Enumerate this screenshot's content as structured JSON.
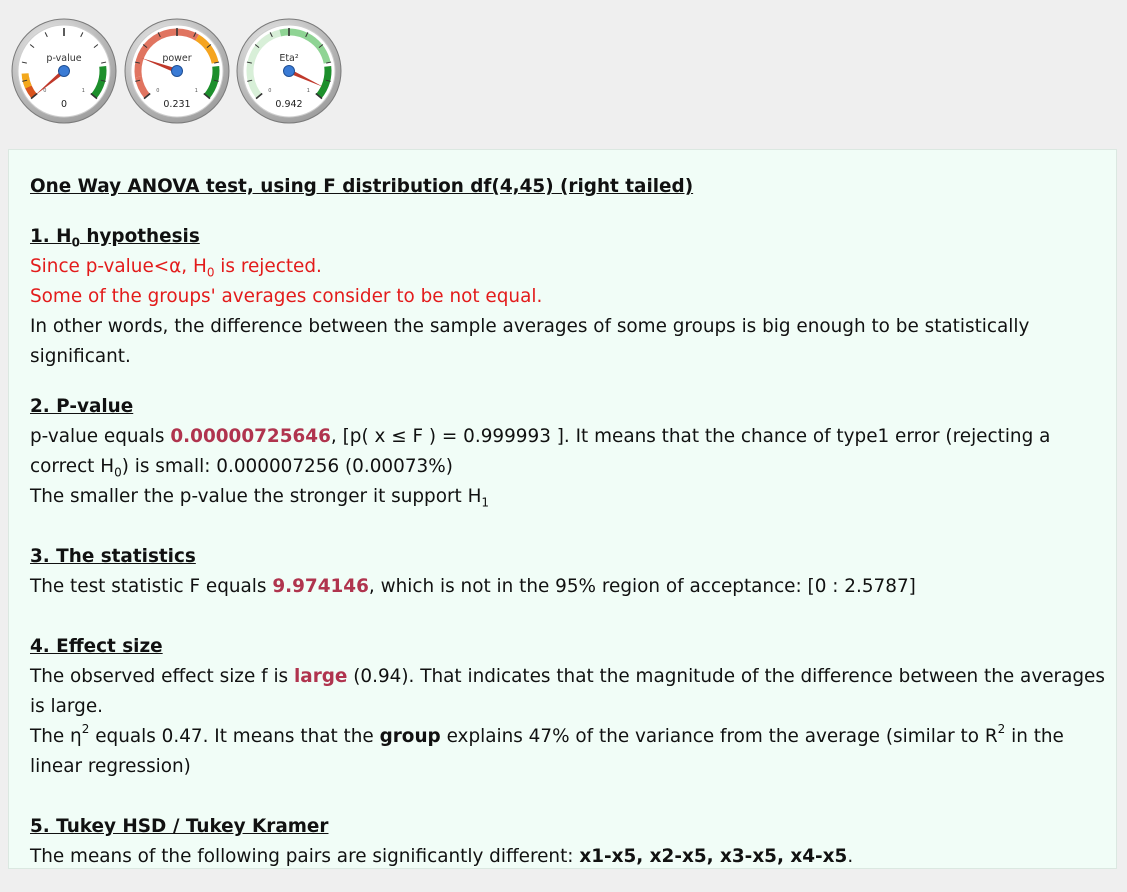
{
  "gauges": [
    {
      "label": "p-value",
      "value_text": "0",
      "value": 0,
      "min_tick": "0",
      "max_tick": "1",
      "colors": {
        "face": "#ffffff",
        "band_low": "#d9541e",
        "band_mid": "#f3a81c",
        "band_high": "#1d8f2c"
      }
    },
    {
      "label": "power",
      "value_text": "0.231",
      "value": 0.231,
      "min_tick": "0",
      "max_tick": "1",
      "colors": {
        "face": "#ffffff",
        "band_low": "#e07460",
        "band_mid": "#f5a41f",
        "band_high": "#1d8f2c"
      }
    },
    {
      "label": "Eta²",
      "value_text": "0.942",
      "value": 0.942,
      "min_tick": "0",
      "max_tick": "1",
      "colors": {
        "face": "#ffffff",
        "band_low": "#d8efd8",
        "band_mid": "#8fd494",
        "band_high": "#1d8f2c"
      }
    }
  ],
  "report": {
    "title": "One Way ANOVA test, using F distribution df(4,45) (right tailed)",
    "s1": {
      "heading_a": "1. H",
      "heading_sub": "0",
      "heading_b": " hypothesis",
      "line1_a": "Since p-value<α, H",
      "line1_sub": "0",
      "line1_b": " is rejected.",
      "line2": "Some of the groups' averages consider to be not equal.",
      "line3": "In other words, the difference between the sample averages of some groups is big enough to be statistically significant."
    },
    "s2": {
      "heading": "2. P-value",
      "a": "p-value equals ",
      "pvalue": "0.00000725646",
      "b": ", [p( x ≤ F ) = 0.999993 ]. It means that the chance of type1 error (rejecting a correct H",
      "b_sub": "0",
      "c": ") is small: 0.000007256 (0.00073%)",
      "line2_a": "The smaller the p-value the stronger it support H",
      "line2_sub": "1"
    },
    "s3": {
      "heading": "3. The statistics",
      "a": "The test statistic F equals ",
      "f": "9.974146",
      "b": ", which is not in the 95% region of acceptance: [0 : 2.5787]"
    },
    "s4": {
      "heading": "4. Effect size",
      "a": "The observed effect size f is ",
      "size": "large",
      "b": " (0.94). That indicates that the magnitude of the difference between the averages is large.",
      "c1": "The η",
      "c_sup": "2",
      "c2": " equals 0.47. It means that the ",
      "group": "group",
      "c3": " explains 47% of the variance from the average (similar to R",
      "c_sup2": "2",
      "c4": " in the linear regression)"
    },
    "s5": {
      "heading": "5. Tukey HSD / Tukey Kramer",
      "a": "The means of the following pairs are significantly different: ",
      "pairs": "x1-x5, x2-x5, x3-x5, x4-x5",
      "b": "."
    }
  }
}
